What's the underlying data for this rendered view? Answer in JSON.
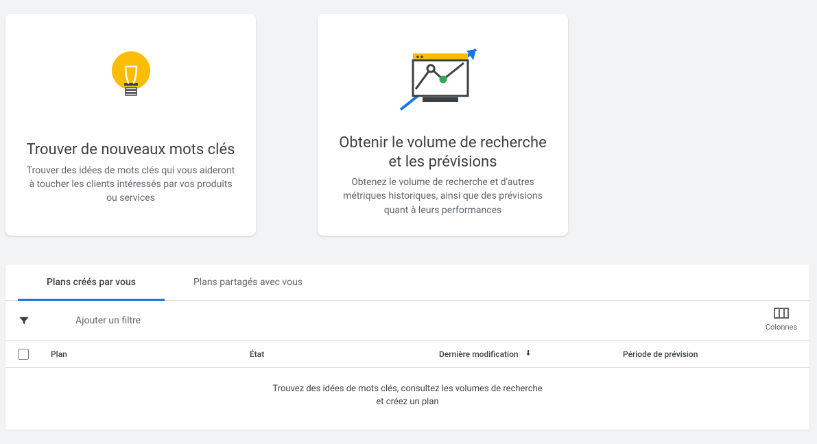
{
  "cards": {
    "find": {
      "title": "Trouver de nouveaux mots clés",
      "desc": "Trouver des idées de mots clés qui vous aideront à toucher les clients intéressés par vos produits ou services"
    },
    "volume": {
      "title": "Obtenir le volume de recherche et les prévisions",
      "desc": "Obtenez le volume de recherche et d'autres métriques historiques, ainsi que des prévisions quant à leurs performances"
    }
  },
  "tabs": {
    "mine": "Plans créés par vous",
    "shared": "Plans partagés avec vous"
  },
  "filter": {
    "placeholder": "Ajouter un filtre",
    "columns_label": "Colonnes"
  },
  "columns": {
    "plan": "Plan",
    "state": "État",
    "modified": "Dernière modification",
    "period": "Période de prévision"
  },
  "empty": "Trouvez des idées de mots clés, consultez les volumes de recherche et créez un plan"
}
